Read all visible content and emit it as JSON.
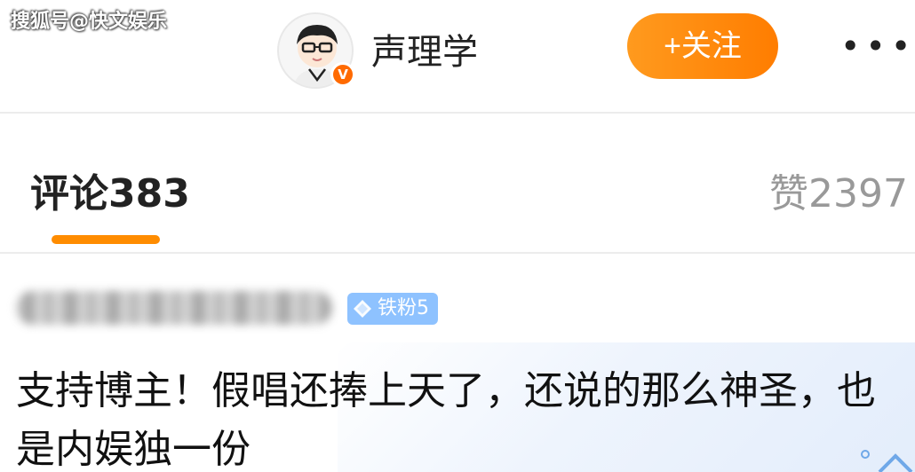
{
  "watermark": {
    "text": "搜狐号@快文娱乐"
  },
  "header": {
    "account_name": "声理学",
    "verified_badge": "V",
    "follow_label": "+关注",
    "more_label": "•••"
  },
  "tabs": {
    "comments_label": "评论383",
    "likes_label": "赞2397"
  },
  "comment": {
    "badge_label": "铁粉5",
    "text": "支持博主！假唱还捧上天了，还说的那么神圣，也是内娱独一份"
  },
  "colors": {
    "accent": "#ff8c00",
    "badge": "#8ec2ff",
    "verified": "#ff6a00"
  }
}
